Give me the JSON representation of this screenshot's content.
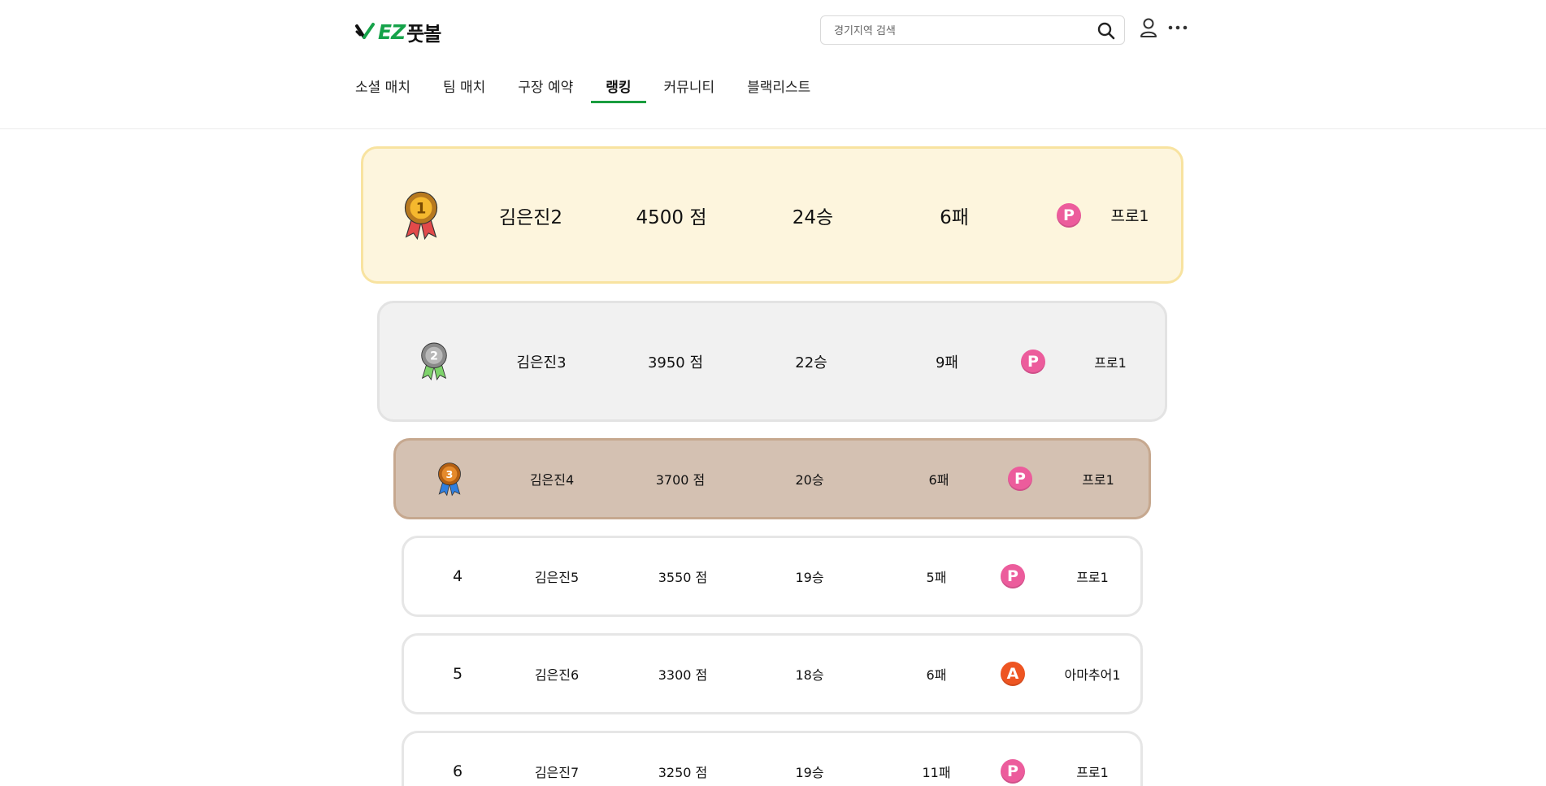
{
  "brand": {
    "logo_en": "EZ",
    "logo_ko": "풋볼",
    "accent_color": "#16a34a"
  },
  "search": {
    "placeholder": "경기지역 검색",
    "value": ""
  },
  "header_icons": {
    "search": "search-icon",
    "user": "user-icon",
    "more": "more-icon"
  },
  "nav": {
    "items": [
      {
        "label": "소셜 매치",
        "active": false
      },
      {
        "label": "팀 매치",
        "active": false
      },
      {
        "label": "구장 예약",
        "active": false
      },
      {
        "label": "랭킹",
        "active": true
      },
      {
        "label": "커뮤니티",
        "active": false
      },
      {
        "label": "블랙리스트",
        "active": false
      }
    ],
    "active_color": "#1a9d3f"
  },
  "ranking": {
    "rows": [
      {
        "rank": "1",
        "medal": "gold-medal-icon",
        "name": "김은진2",
        "points": "4500 점",
        "wins": "24승",
        "losses": "6패",
        "tier_letter": "P",
        "tier": "프로1"
      },
      {
        "rank": "2",
        "medal": "silver-medal-icon",
        "name": "김은진3",
        "points": "3950 점",
        "wins": "22승",
        "losses": "9패",
        "tier_letter": "P",
        "tier": "프로1"
      },
      {
        "rank": "3",
        "medal": "bronze-medal-icon",
        "name": "김은진4",
        "points": "3700 점",
        "wins": "20승",
        "losses": "6패",
        "tier_letter": "P",
        "tier": "프로1"
      },
      {
        "rank": "4",
        "name": "김은진5",
        "points": "3550 점",
        "wins": "19승",
        "losses": "5패",
        "tier_letter": "P",
        "tier": "프로1"
      },
      {
        "rank": "5",
        "name": "김은진6",
        "points": "3300 점",
        "wins": "18승",
        "losses": "6패",
        "tier_letter": "A",
        "tier": "아마추어1"
      },
      {
        "rank": "6",
        "name": "김은진7",
        "points": "3250 점",
        "wins": "19승",
        "losses": "11패",
        "tier_letter": "P",
        "tier": "프로1"
      }
    ],
    "colors": {
      "gold_bg": "#fdf5dd",
      "gold_border": "#f8e3a0",
      "silver_bg": "#f1f1f1",
      "silver_border": "#e3e3e3",
      "bronze_bg": "#d4c1b2",
      "bronze_border": "#c6a88f",
      "plain_bg": "#ffffff",
      "plain_border": "#e6e6e6",
      "pro_badge": "#ec5c9c",
      "amateur_badge": "#ee5522"
    }
  }
}
